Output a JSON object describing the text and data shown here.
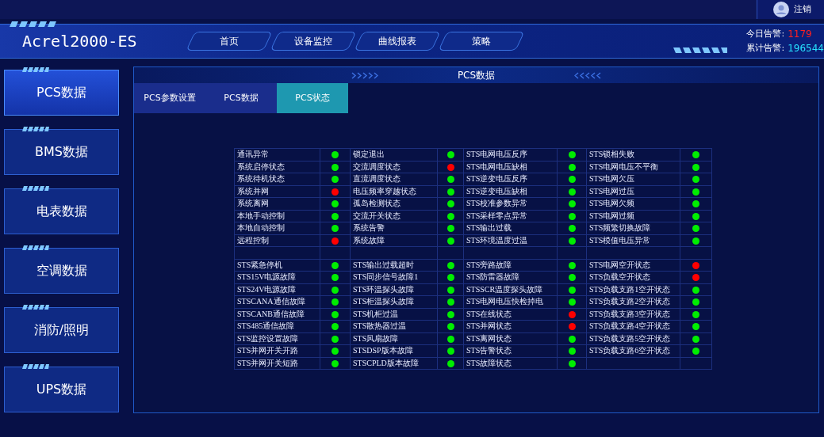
{
  "topbar": {
    "logout": "注销"
  },
  "header": {
    "title": "Acrel2000-ES",
    "nav": [
      {
        "label": "首页"
      },
      {
        "label": "设备监控"
      },
      {
        "label": "曲线报表"
      },
      {
        "label": "策略"
      }
    ],
    "alarms": [
      {
        "label": "今日告警:",
        "value": "1179",
        "color": "#ff2020"
      },
      {
        "label": "累计告警:",
        "value": "196544",
        "color": "#27e3ff"
      }
    ]
  },
  "sidebar": {
    "items": [
      {
        "label": "PCS数据",
        "selected": true
      },
      {
        "label": "BMS数据",
        "selected": false
      },
      {
        "label": "电表数据",
        "selected": false
      },
      {
        "label": "空调数据",
        "selected": false
      },
      {
        "label": "消防/照明",
        "selected": false
      },
      {
        "label": "UPS数据",
        "selected": false
      }
    ]
  },
  "panel": {
    "title": "PCS数据",
    "tabs": [
      {
        "label": "PCS参数设置",
        "selected": false
      },
      {
        "label": "PCS数据",
        "selected": false
      },
      {
        "label": "PCS状态",
        "selected": true
      }
    ],
    "sections": [
      {
        "rows": [
          [
            {
              "label": "通讯异常",
              "color": "#00ee00"
            },
            {
              "label": "锁定退出",
              "color": "#00ee00"
            },
            {
              "label": "STS电网电压反序",
              "color": "#00ee00"
            },
            {
              "label": "STS锁相失败",
              "color": "#00ee00"
            }
          ],
          [
            {
              "label": "系统启停状态",
              "color": "#00ee00"
            },
            {
              "label": "交流调度状态",
              "color": "#ff0000"
            },
            {
              "label": "STS电网电压缺相",
              "color": "#00ee00"
            },
            {
              "label": "STS电网电压不平衡",
              "color": "#00ee00"
            }
          ],
          [
            {
              "label": "系统待机状态",
              "color": "#00ee00"
            },
            {
              "label": "直流调度状态",
              "color": "#00ee00"
            },
            {
              "label": "STS逆变电压反序",
              "color": "#00ee00"
            },
            {
              "label": "STS电网欠压",
              "color": "#00ee00"
            }
          ],
          [
            {
              "label": "系统并网",
              "color": "#ff0000"
            },
            {
              "label": "电压频率穿越状态",
              "color": "#00ee00"
            },
            {
              "label": "STS逆变电压缺相",
              "color": "#00ee00"
            },
            {
              "label": "STS电网过压",
              "color": "#00ee00"
            }
          ],
          [
            {
              "label": "系统离网",
              "color": "#00ee00"
            },
            {
              "label": "孤岛检测状态",
              "color": "#00ee00"
            },
            {
              "label": "STS校准参数异常",
              "color": "#00ee00"
            },
            {
              "label": "STS电网欠频",
              "color": "#00ee00"
            }
          ],
          [
            {
              "label": "本地手动控制",
              "color": "#00ee00"
            },
            {
              "label": "交流开关状态",
              "color": "#00ee00"
            },
            {
              "label": "STS采样零点异常",
              "color": "#00ee00"
            },
            {
              "label": "STS电网过频",
              "color": "#00ee00"
            }
          ],
          [
            {
              "label": "本地自动控制",
              "color": "#00ee00"
            },
            {
              "label": "系统告警",
              "color": "#00ee00"
            },
            {
              "label": "STS输出过载",
              "color": "#00ee00"
            },
            {
              "label": "STS频繁切换故障",
              "color": "#00ee00"
            }
          ],
          [
            {
              "label": "远程控制",
              "color": "#ff0000"
            },
            {
              "label": "系统故障",
              "color": "#00ee00"
            },
            {
              "label": "STS环境温度过温",
              "color": "#00ee00"
            },
            {
              "label": "STS模值电压异常",
              "color": "#00ee00"
            }
          ]
        ]
      },
      {
        "rows": [
          [
            {
              "label": "STS紧急停机",
              "color": "#00ee00"
            },
            {
              "label": "STS输出过载超时",
              "color": "#00ee00"
            },
            {
              "label": "STS旁路故障",
              "color": "#00ee00"
            },
            {
              "label": "STS电网空开状态",
              "color": "#ff0000"
            }
          ],
          [
            {
              "label": "STS15V电源故障",
              "color": "#00ee00"
            },
            {
              "label": "STS同步信号故障1",
              "color": "#00ee00"
            },
            {
              "label": "STS防雷器故障",
              "color": "#00ee00"
            },
            {
              "label": "STS负载空开状态",
              "color": "#ff0000"
            }
          ],
          [
            {
              "label": "STS24V电源故障",
              "color": "#00ee00"
            },
            {
              "label": "STS环温探头故障",
              "color": "#00ee00"
            },
            {
              "label": "STSSCR温度探头故障",
              "color": "#00ee00"
            },
            {
              "label": "STS负载支路1空开状态",
              "color": "#00ee00"
            }
          ],
          [
            {
              "label": "STSCANA通信故障",
              "color": "#00ee00"
            },
            {
              "label": "STS柜温探头故障",
              "color": "#00ee00"
            },
            {
              "label": "STS电网电压快检掉电",
              "color": "#00ee00"
            },
            {
              "label": "STS负载支路2空开状态",
              "color": "#00ee00"
            }
          ],
          [
            {
              "label": "STSCANB通信故障",
              "color": "#00ee00"
            },
            {
              "label": "STS机柜过温",
              "color": "#00ee00"
            },
            {
              "label": "STS在线状态",
              "color": "#ff0000"
            },
            {
              "label": "STS负载支路3空开状态",
              "color": "#00ee00"
            }
          ],
          [
            {
              "label": "STS485通信故障",
              "color": "#00ee00"
            },
            {
              "label": "STS散热器过温",
              "color": "#00ee00"
            },
            {
              "label": "STS并网状态",
              "color": "#ff0000"
            },
            {
              "label": "STS负载支路4空开状态",
              "color": "#00ee00"
            }
          ],
          [
            {
              "label": "STS监控设置故障",
              "color": "#00ee00"
            },
            {
              "label": "STS风扇故障",
              "color": "#00ee00"
            },
            {
              "label": "STS离网状态",
              "color": "#00ee00"
            },
            {
              "label": "STS负载支路5空开状态",
              "color": "#00ee00"
            }
          ],
          [
            {
              "label": "STS并网开关开路",
              "color": "#00ee00"
            },
            {
              "label": "STSDSP版本故障",
              "color": "#00ee00"
            },
            {
              "label": "STS告警状态",
              "color": "#00ee00"
            },
            {
              "label": "STS负载支路6空开状态",
              "color": "#00ee00"
            }
          ],
          [
            {
              "label": "STS并网开关短路",
              "color": "#00ee00"
            },
            {
              "label": "STSCPLD版本故障",
              "color": "#00ee00"
            },
            {
              "label": "STS故障状态",
              "color": "#00ee00"
            }
          ]
        ]
      }
    ]
  }
}
